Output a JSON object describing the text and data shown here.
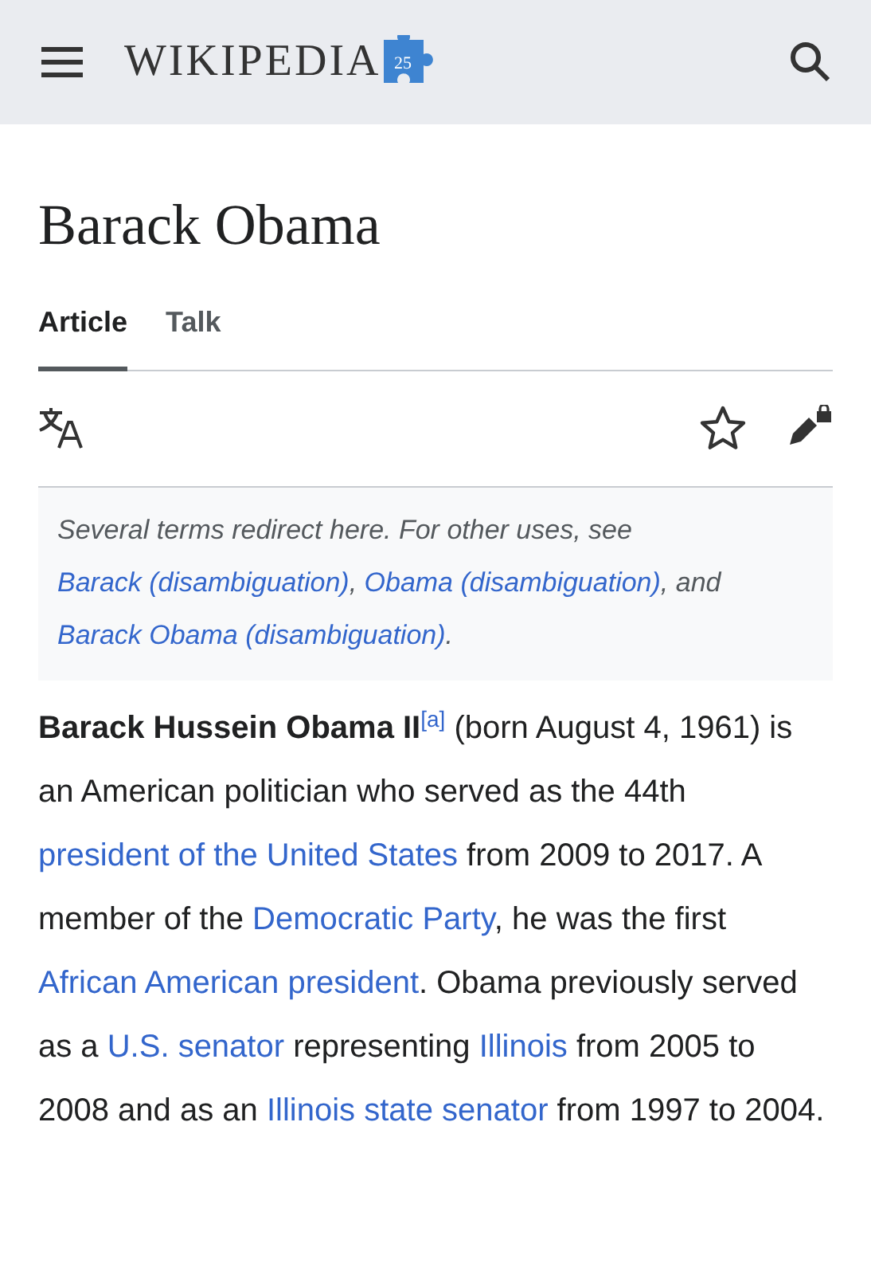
{
  "header": {
    "logo_text": "WIKIPEDIA",
    "logo_badge": "25"
  },
  "title": "Barack Obama",
  "tabs": [
    {
      "label": "Article",
      "selected": true
    },
    {
      "label": "Talk",
      "selected": false
    }
  ],
  "hatnote": [
    {
      "kind": "text",
      "text": "Several terms redirect here. For other uses, see "
    },
    {
      "kind": "link",
      "text": "Barack (disambiguation)"
    },
    {
      "kind": "text",
      "text": ", "
    },
    {
      "kind": "link",
      "text": "Obama (disambiguation)"
    },
    {
      "kind": "text",
      "text": ", and "
    },
    {
      "kind": "link",
      "text": "Barack Obama (disambiguation)"
    },
    {
      "kind": "text",
      "text": "."
    }
  ],
  "paragraph": [
    {
      "kind": "bold",
      "text": "Barack Hussein Obama II"
    },
    {
      "kind": "ref",
      "text": "[a]"
    },
    {
      "kind": "text",
      "text": " (born August 4, 1961) is an American politician who served as the 44th "
    },
    {
      "kind": "link",
      "text": "president of the United States"
    },
    {
      "kind": "text",
      "text": " from 2009 to 2017. A member of the "
    },
    {
      "kind": "link",
      "text": "Democratic Party"
    },
    {
      "kind": "text",
      "text": ", he was the first "
    },
    {
      "kind": "link",
      "text": "African American president"
    },
    {
      "kind": "text",
      "text": ". Obama previously served as a "
    },
    {
      "kind": "link",
      "text": "U.S. senator"
    },
    {
      "kind": "text",
      "text": " representing "
    },
    {
      "kind": "link",
      "text": "Illinois"
    },
    {
      "kind": "text",
      "text": " from 2005 to 2008 and as an "
    },
    {
      "kind": "link",
      "text": "Illinois state senator"
    },
    {
      "kind": "text",
      "text": " from 1997 to 2004."
    }
  ]
}
